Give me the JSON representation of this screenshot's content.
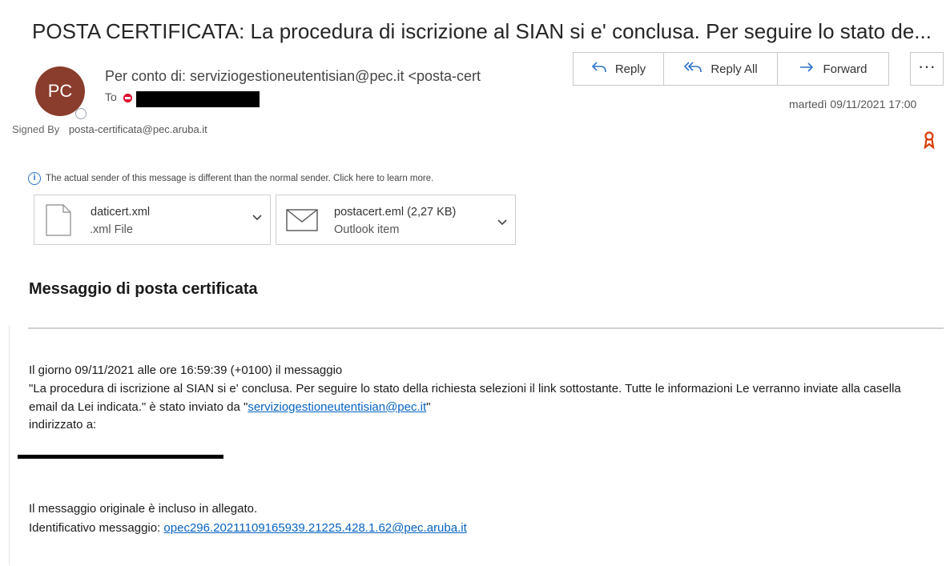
{
  "subject": "POSTA CERTIFICATA: La procedura di iscrizione al SIAN si e' conclusa. Per seguire lo stato de...",
  "sender": {
    "initials": "PC",
    "from_line": "Per conto di: serviziogestioneutentisian@pec.it <posta-cert",
    "to_label": "To",
    "signed_by_label": "Signed By",
    "signed_by_value": "posta-certificata@pec.aruba.it"
  },
  "actions": {
    "reply": "Reply",
    "reply_all": "Reply All",
    "forward": "Forward",
    "more": "···"
  },
  "date": "martedì 09/11/2021 17:00",
  "infobar": "The actual sender of this message is different than the normal sender. Click here to learn more.",
  "attachments": [
    {
      "name": "daticert.xml",
      "type": ".xml File"
    },
    {
      "name": "postacert.eml (2,27 KB)",
      "type": "Outlook item"
    }
  ],
  "message": {
    "title": "Messaggio di posta certificata",
    "line1": "Il giorno 09/11/2021 alle ore 16:59:39 (+0100) il messaggio",
    "line2": "\"La procedura di iscrizione al SIAN si e' conclusa. Per seguire lo stato della richiesta selezioni il link sottostante. Tutte le informazioni Le verranno inviate alla casella email da Lei indicata.\" è stato inviato da \"",
    "sender_link": "serviziogestioneutentisian@pec.it",
    "line2_end": "\"",
    "line3": "indirizzato a:",
    "included": "Il messaggio originale è incluso in allegato.",
    "id_label": "Identificativo messaggio: ",
    "id_link": "opec296.20211109165939.21225.428.1.62@pec.aruba.it"
  },
  "colors": {
    "avatar": "#8a3d2c",
    "accent": "#2b74c8",
    "link": "#0563c1"
  }
}
